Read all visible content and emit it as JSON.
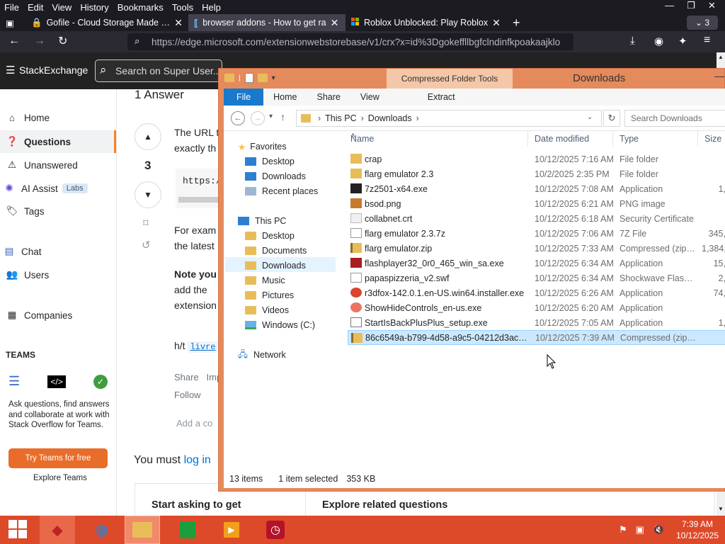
{
  "browser": {
    "menu": [
      "File",
      "Edit",
      "View",
      "History",
      "Bookmarks",
      "Tools",
      "Help"
    ],
    "tabs": [
      {
        "title": "Gofile - Cloud Storage Made Sim",
        "active": false
      },
      {
        "title": "browser addons - How to get ra",
        "active": true
      },
      {
        "title": "Roblox Unblocked: Play Roblox",
        "active": false
      }
    ],
    "tab_count": "3",
    "url": "https://edge.microsoft.com/extensionwebstorebase/v1/crx?x=id%3Dgokeffllbgfclndinfkpoakaajklo"
  },
  "stack": {
    "logo_text": "StackExchange",
    "search_placeholder": "Search on Super User...",
    "answer_heading": "1 Answer",
    "vote_count": "3",
    "nav": {
      "home": "Home",
      "questions": "Questions",
      "unanswered": "Unanswered",
      "ai_assist": "AI Assist",
      "labs": "Labs",
      "tags": "Tags",
      "chat": "Chat",
      "users": "Users",
      "companies": "Companies"
    },
    "teams_heading": "TEAMS",
    "teams_desc": "Ask questions, find answers and collaborate at work with Stack Overflow for Teams.",
    "teams_button": "Try Teams for free",
    "explore_teams": "Explore Teams",
    "answer_lines": [
      "The URL t",
      "exactly th",
      "For exam",
      "the latest",
      "Note you",
      "add the",
      "extension"
    ],
    "code_snip": "https:/",
    "ht_label": "h/t",
    "ht_user": "livre",
    "share": "Share",
    "improve": "Imp",
    "follow": "Follow",
    "add_comment": "Add a co",
    "must_login": "You must",
    "login_link": "log in",
    "bottom_left": "Start asking to get",
    "bottom_right": "Explore related questions"
  },
  "explorer": {
    "title": "Downloads",
    "context_tab": "Compressed Folder Tools",
    "ribbon_tabs": [
      "File",
      "Home",
      "Share",
      "View"
    ],
    "extract": "Extract",
    "breadcrumb": [
      "This PC",
      "Downloads"
    ],
    "search_placeholder": "Search Downloads",
    "columns": {
      "name": "Name",
      "date": "Date modified",
      "type": "Type",
      "size": "Size"
    },
    "tree": {
      "favorites": "Favorites",
      "fav_items": [
        "Desktop",
        "Downloads",
        "Recent places"
      ],
      "this_pc": "This PC",
      "pc_items": [
        "Desktop",
        "Documents",
        "Downloads",
        "Music",
        "Pictures",
        "Videos",
        "Windows (C:)"
      ],
      "network": "Network"
    },
    "files": [
      {
        "name": "crap",
        "date": "10/12/2025 7:16 AM",
        "type": "File folder",
        "size": "",
        "icon": "folder-icon"
      },
      {
        "name": "flarg emulator 2.3",
        "date": "10/2/2025 2:35 PM",
        "type": "File folder",
        "size": "",
        "icon": "folder-icon"
      },
      {
        "name": "7z2501-x64.exe",
        "date": "10/12/2025 7:08 AM",
        "type": "Application",
        "size": "1,",
        "icon": "7zip-icon"
      },
      {
        "name": "bsod.png",
        "date": "10/12/2025 6:21 AM",
        "type": "PNG image",
        "size": "",
        "icon": "image-icon"
      },
      {
        "name": "collabnet.crt",
        "date": "10/12/2025 6:18 AM",
        "type": "Security Certificate",
        "size": "",
        "icon": "certificate-icon"
      },
      {
        "name": "flarg emulator 2.3.7z",
        "date": "10/12/2025 7:06 AM",
        "type": "7Z File",
        "size": "345,",
        "icon": "file-icon"
      },
      {
        "name": "flarg emulator.zip",
        "date": "10/12/2025 7:33 AM",
        "type": "Compressed (zipp...",
        "size": "1,384,",
        "icon": "zip-icon"
      },
      {
        "name": "flashplayer32_0r0_465_win_sa.exe",
        "date": "10/12/2025 6:34 AM",
        "type": "Application",
        "size": "15,",
        "icon": "flash-icon"
      },
      {
        "name": "papaspizzeria_v2.swf",
        "date": "10/12/2025 6:34 AM",
        "type": "Shockwave Flash ...",
        "size": "2,",
        "icon": "file-icon"
      },
      {
        "name": "r3dfox-142.0.1.en-US.win64.installer.exe",
        "date": "10/12/2025 6:26 AM",
        "type": "Application",
        "size": "74,",
        "icon": "r3dfox-icon"
      },
      {
        "name": "ShowHideControls_en-us.exe",
        "date": "10/12/2025 6:20 AM",
        "type": "Application",
        "size": "",
        "icon": "settings-icon"
      },
      {
        "name": "StartIsBackPlusPlus_setup.exe",
        "date": "10/12/2025 7:05 AM",
        "type": "Application",
        "size": "1,",
        "icon": "app-icon"
      },
      {
        "name": "86c6549a-b799-4d58-a9c5-04212d3ac17e...",
        "date": "10/12/2025 7:39 AM",
        "type": "Compressed (zipp...",
        "size": "",
        "icon": "zip-icon",
        "selected": true
      }
    ],
    "status_items": "13 items",
    "status_selected": "1 item selected",
    "status_size": "353 KB"
  },
  "taskbar": {
    "time": "7:39 AM",
    "date": "10/12/2025"
  }
}
